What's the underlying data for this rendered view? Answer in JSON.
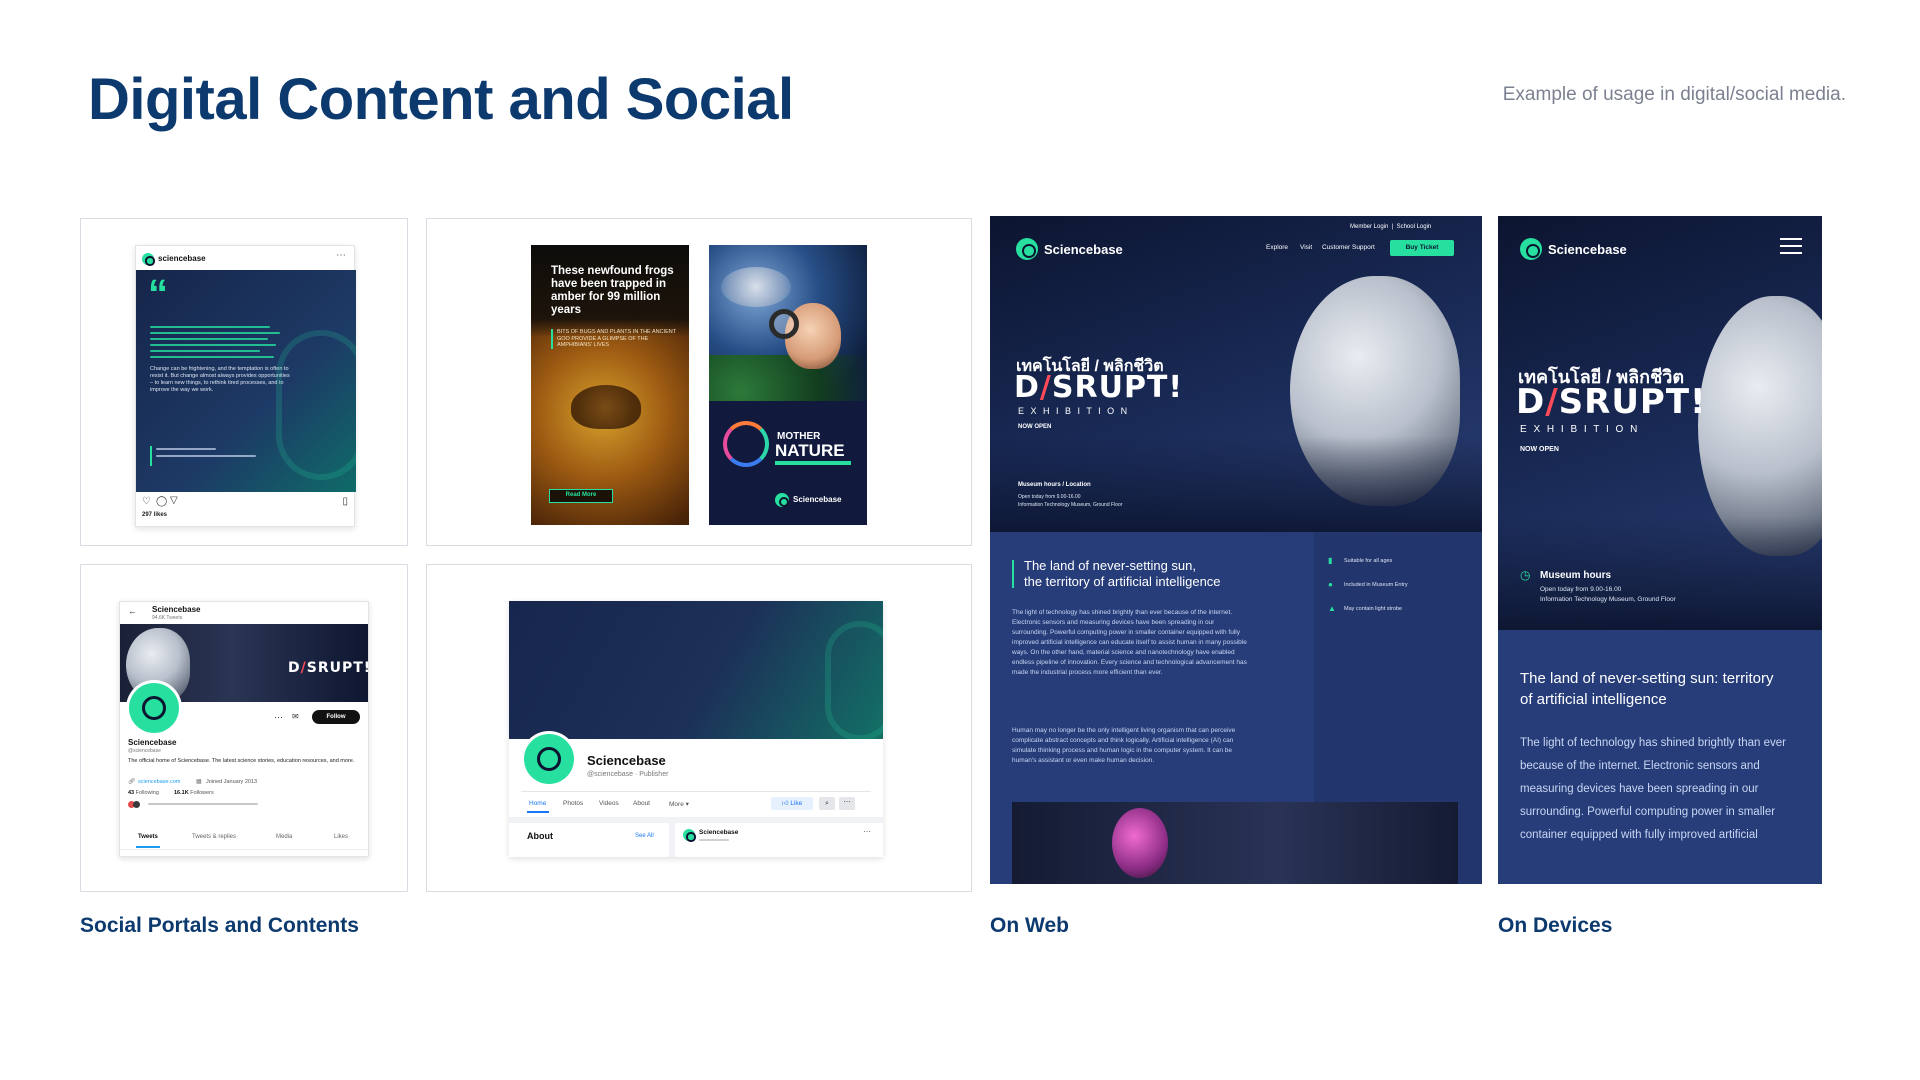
{
  "header": {
    "title": "Digital Content and Social",
    "subtitle": "Example of usage in digital/social media."
  },
  "captions": {
    "social": "Social Portals and Contents",
    "web": "On Web",
    "devices": "On Devices"
  },
  "instagram": {
    "account": "sciencebase",
    "quote_mark": "“",
    "body_en": "Change can be frightening, and the temptation is often to resist it. But change almost always provides opportunities – to learn new things, to rethink tired processes, and to improve the way we work.",
    "likes": "297 likes"
  },
  "amber_post": {
    "headline": "These newfound frogs have been trapped in amber for 99 million years",
    "sub": "BITS OF BUGS AND PLANTS IN THE ANCIENT GOO PROVIDE A GLIMPSE OF THE AMPHIBIANS' LIVES",
    "button": "Read More"
  },
  "nature_post": {
    "brand_line1": "MOTHER",
    "brand_line2": "NATURE",
    "logo": "Sciencebase"
  },
  "twitter": {
    "name": "Sciencebase",
    "tweets": "94.6K Tweets",
    "handle": "@sciencebase",
    "bio": "The official home of Sciencebase. The latest science stories, education resources, and more.",
    "link": "sciencebase.com",
    "joined": "Joined January 2013",
    "following_count": "43",
    "following_label": "Following",
    "followers_count": "16.1K",
    "followers_label": "Followers",
    "follow_btn": "Follow",
    "banner_title": "D/SRUPT!",
    "tabs": [
      "Tweets",
      "Tweets & replies",
      "Media",
      "Likes"
    ]
  },
  "facebook": {
    "name": "Sciencebase",
    "handle": "@sciencebase · Publisher",
    "tabs": [
      "Home",
      "Photos",
      "Videos",
      "About",
      "More ▾"
    ],
    "like_btn": "Like",
    "about": "About",
    "see_all": "See All",
    "post_name": "Sciencebase"
  },
  "web": {
    "logo": "Sciencebase",
    "top_links": "Member Login  |  School Login",
    "nav": [
      "Explore",
      "Visit",
      "Customer Support"
    ],
    "cta": "Buy Ticket",
    "thai_title": "เทคโนโลยี / พลิกชีวิต",
    "disrupt": "D/SRUPT!",
    "exhibition": "E X H I B I T I O N",
    "now_open": "NOW OPEN",
    "museum_label": "Museum hours / Location",
    "museum_line1": "Open today from 9.00-16.00",
    "museum_line2": "Information Technology Museum, Ground Floor",
    "tagline_1": "The land of never-setting sun,",
    "tagline_2": "the territory of artificial intelligence",
    "para1": "The light of technology has shined brightly than ever because of the internet. Electronic sensors and measuring devices have been spreading in our surrounding. Powerful computing power in smaller container equipped with fully improved artificial intelligence can educate itself to assist human in many possible ways. On the other hand, material science and nanotechnology have enabled endless pipeline of innovation. Every science and technological advancement has made the industrial process more efficient than ever.",
    "para2": "Human may no longer be the only intelligent living organism that can perceive complicate abstract concepts and think logically. Artificial intelligence (AI) can simulate thinking process and human logic in the computer system. It can be human's assistant or even make human decision.",
    "features": [
      "Suitable for all ages",
      "Included in Museum Entry",
      "May contain light strobe"
    ]
  },
  "device": {
    "logo": "Sciencebase",
    "thai_title": "เทคโนโลยี / พลิกชีวิต",
    "disrupt": "D/SRUPT!",
    "exhibition": "E X H I B I T I O N",
    "now_open": "NOW OPEN",
    "museum_label": "Museum hours",
    "museum_line1": "Open today from 9.00-16.00",
    "museum_line2": "Information Technology Museum, Ground Floor",
    "tagline": "The land of never-setting sun: territory of artificial intelligence",
    "para": "The light of technology has shined brightly than ever because of the internet. Electronic sensors and measuring devices have been spreading in our surrounding. Powerful computing power in smaller container equipped with fully improved artificial"
  },
  "colors": {
    "title": "#0d3a6e",
    "accent": "#27e0a0",
    "navy": "#1b2a52",
    "highlight": "#ff4a5a"
  }
}
